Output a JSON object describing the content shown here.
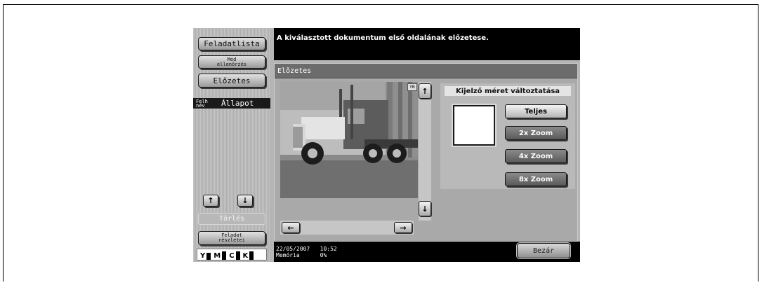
{
  "sidebar": {
    "job_list_label": "Feladatlista",
    "verify_label_line1": "Méd",
    "verify_label_line2": "ellenőrzés",
    "preview_label": "Előzetes",
    "status_head_line1": "Felh",
    "status_head_line2": "név",
    "status_head_label": "Állapot",
    "up_arrow": "↑",
    "down_arrow": "↓",
    "delete_label": "Törlés",
    "details_line1": "Feladat",
    "details_line2": "részletei",
    "toner": [
      {
        "letter": "Y"
      },
      {
        "letter": "M"
      },
      {
        "letter": "C"
      },
      {
        "letter": "K"
      }
    ]
  },
  "message": "A kiválasztott dokumentum első oldalának előzetese.",
  "window": {
    "title": "Előzetes",
    "page_badge": "YB",
    "scroll_up": "↑",
    "scroll_down": "↓",
    "scroll_left": "←",
    "scroll_right": "→"
  },
  "display_size": {
    "title": "Kijelző méret változtatása",
    "full": "Teljes",
    "zoom2": "2x Zoom",
    "zoom4": "4x Zoom",
    "zoom8": "8x Zoom"
  },
  "footer": {
    "date": "22/05/2007",
    "time": "10:52",
    "memory_label": "Memória",
    "memory_value": "0%",
    "close_label": "Bezár"
  },
  "colors": {
    "panel_bg": "#b5b5b5",
    "bar_black": "#000000",
    "selected_button": "#5a5a5a"
  }
}
